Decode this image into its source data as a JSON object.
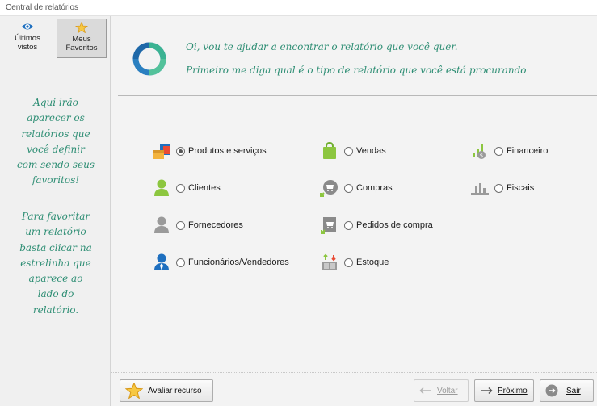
{
  "window": {
    "title": "Central de relatórios"
  },
  "sidebar": {
    "tabs": [
      {
        "label_line1": "Últimos",
        "label_line2": "vistos",
        "icon": "eye-icon"
      },
      {
        "label_line1": "Meus",
        "label_line2": "Favoritos",
        "icon": "star-icon"
      }
    ],
    "message_lines": [
      "Aqui irão",
      "aparecer os",
      "relatórios que",
      "você definir",
      "com sendo seus",
      "favoritos!",
      "",
      "Para favoritar",
      "um relatório",
      "basta clicar na",
      "estrelinha que",
      "aparece ao",
      "lado do",
      "relatório."
    ]
  },
  "header": {
    "line1": "Oi, vou te ajudar a encontrar o relatório que você quer.",
    "line2": "Primeiro me diga qual é o tipo de relatório que você está procurando"
  },
  "options": {
    "col1": [
      {
        "label": "Produtos e serviços",
        "selected": true,
        "icon": "products-icon"
      },
      {
        "label": "Clientes",
        "selected": false,
        "icon": "client-icon"
      },
      {
        "label": "Fornecedores",
        "selected": false,
        "icon": "supplier-icon"
      },
      {
        "label": "Funcionários/Vendedores",
        "selected": false,
        "icon": "employee-icon"
      }
    ],
    "col2": [
      {
        "label": "Vendas",
        "selected": false,
        "icon": "shopping-bag-icon"
      },
      {
        "label": "Compras",
        "selected": false,
        "icon": "purchase-icon"
      },
      {
        "label": "Pedidos de compra",
        "selected": false,
        "icon": "purchase-order-icon"
      },
      {
        "label": "Estoque",
        "selected": false,
        "icon": "stock-icon"
      }
    ],
    "col3": [
      {
        "label": "Financeiro",
        "selected": false,
        "icon": "finance-icon"
      },
      {
        "label": "Fiscais",
        "selected": false,
        "icon": "fiscal-icon"
      }
    ]
  },
  "footer": {
    "rate_label": "Avaliar recurso",
    "back_label": "Voltar",
    "next_label": "Próximo",
    "exit_label": "Sair"
  },
  "colors": {
    "accent": "#2e8e74",
    "green": "#8cc63f",
    "blue": "#1e6fbf"
  }
}
